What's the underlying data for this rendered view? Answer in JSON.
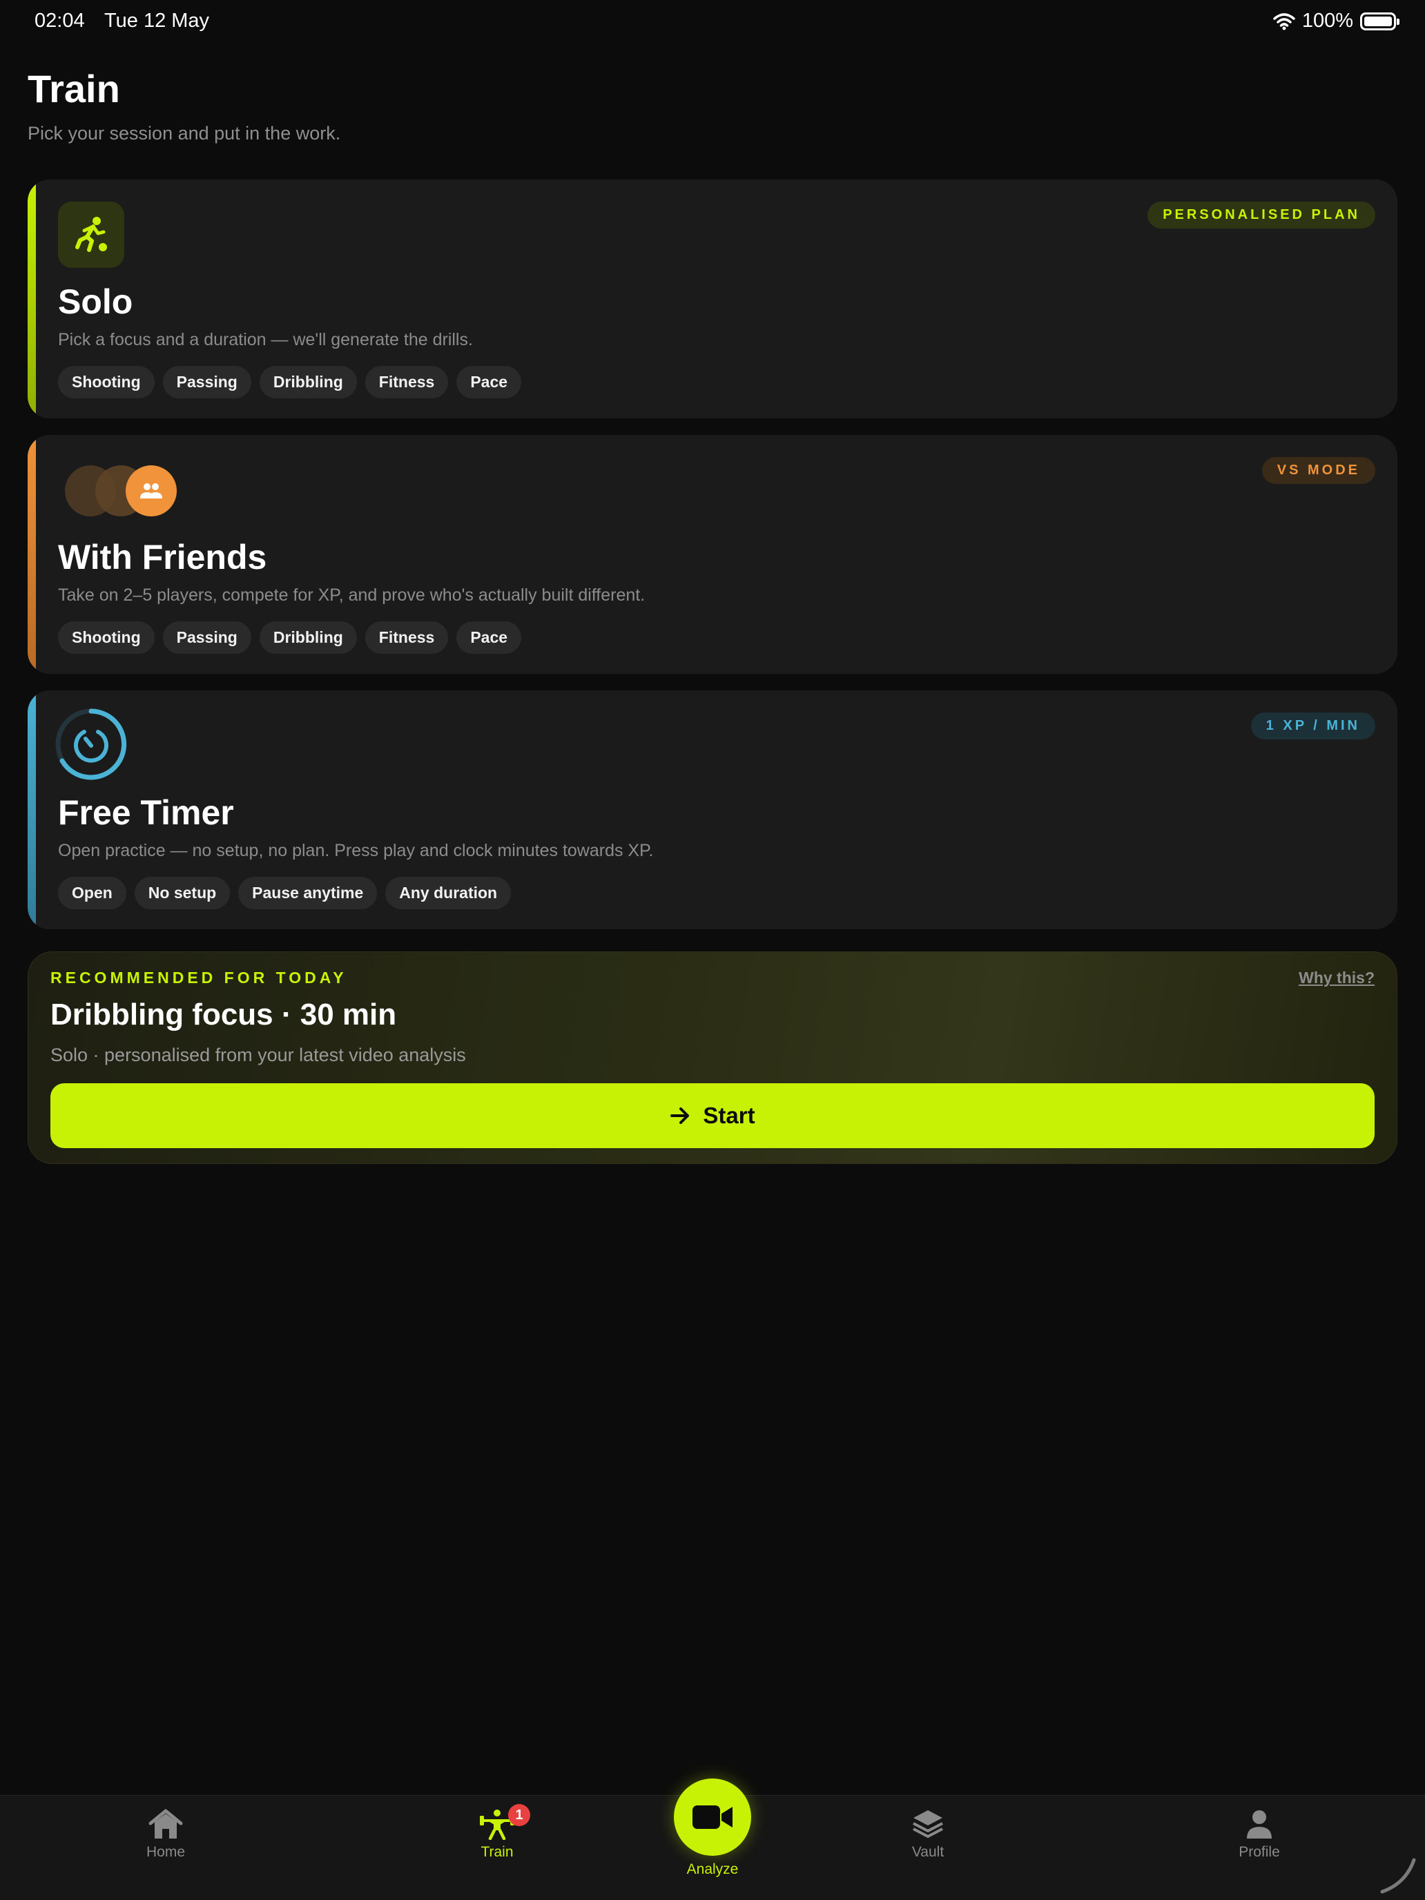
{
  "status_bar": {
    "time": "02:04",
    "date": "Tue 12 May",
    "battery": "100%"
  },
  "header": {
    "title": "Train",
    "subtitle": "Pick your session and put in the work."
  },
  "cards": [
    {
      "name": "Solo",
      "description": "Pick a focus and a duration — we'll generate the drills.",
      "badge": "PERSONALISED PLAN",
      "icon": "runner-icon",
      "accent_color": "#c8f205",
      "chips": [
        "Shooting",
        "Passing",
        "Dribbling",
        "Fitness",
        "Pace"
      ]
    },
    {
      "name": "With Friends",
      "description": "Take on 2–5 players, compete for XP, and prove who's actually built different.",
      "badge": "VS MODE",
      "icon": "group-icon",
      "accent_color": "#f0933a",
      "chips": [
        "Shooting",
        "Passing",
        "Dribbling",
        "Fitness",
        "Pace"
      ]
    },
    {
      "name": "Free Timer",
      "description": "Open practice — no setup, no plan. Press play and clock minutes towards XP.",
      "badge": "1 XP / MIN",
      "icon": "timer-icon",
      "accent_color": "#4bb3d6",
      "chips": [
        "Open",
        "No setup",
        "Pause anytime",
        "Any duration"
      ]
    }
  ],
  "recommended": {
    "kicker": "RECOMMENDED FOR TODAY",
    "why_link": "Why this?",
    "title": "Dribbling focus · 30 min",
    "subtitle": "Solo · personalised from your latest video analysis",
    "button": "Start"
  },
  "tabbar": {
    "items": [
      {
        "label": "Home",
        "icon": "home-icon"
      },
      {
        "label": "Train",
        "icon": "weightlifter-icon",
        "active": true,
        "badge": "1"
      },
      {
        "label": "Analyze",
        "icon": "video-camera-icon"
      },
      {
        "label": "Vault",
        "icon": "layers-icon"
      },
      {
        "label": "Profile",
        "icon": "person-icon"
      }
    ]
  },
  "colors": {
    "accent": "#c8f205",
    "background": "#0c0c0c",
    "card": "#1b1b1b"
  }
}
